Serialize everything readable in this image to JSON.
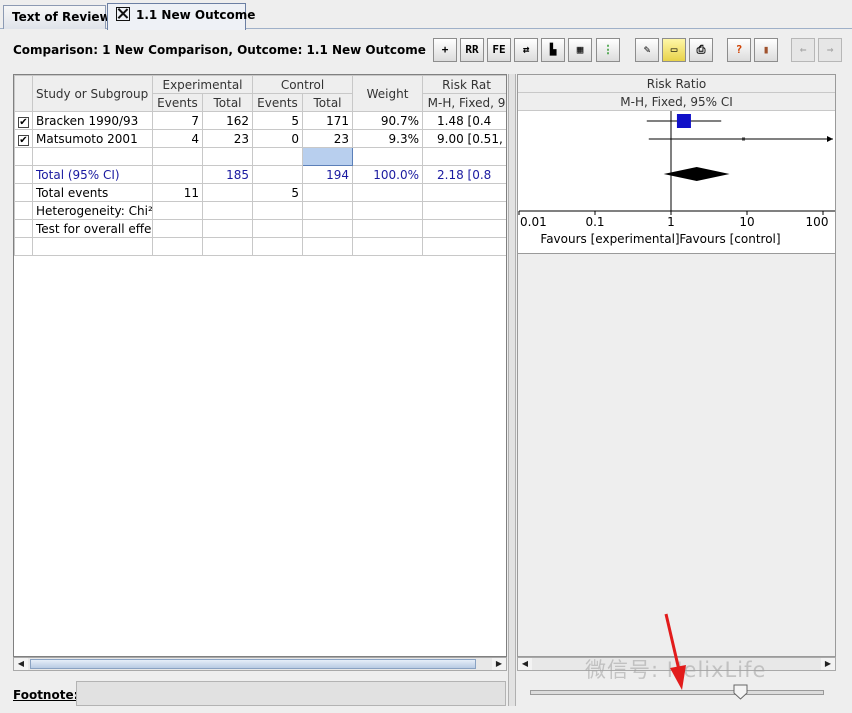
{
  "tabs": [
    {
      "label": "Text of Review"
    },
    {
      "label": "1.1 New Outcome"
    }
  ],
  "title": "Comparison: 1 New Comparison, Outcome: 1.1 New Outcome",
  "toolbar": {
    "buttons": [
      {
        "name": "add-study-icon",
        "label": "+"
      },
      {
        "name": "rr-button",
        "label": "RR"
      },
      {
        "name": "fe-button",
        "label": "FE"
      },
      {
        "name": "sort-icon",
        "label": "⇄"
      },
      {
        "name": "graph-icon",
        "label": "▙"
      },
      {
        "name": "calculator-icon",
        "label": "▦"
      },
      {
        "name": "grid-icon",
        "label": "⋮"
      },
      {
        "name": "properties-icon",
        "label": "✎"
      },
      {
        "name": "note-icon",
        "label": "▭"
      },
      {
        "name": "print-icon",
        "label": "⎙"
      },
      {
        "name": "help-icon",
        "label": "?"
      },
      {
        "name": "book-icon",
        "label": "▮"
      },
      {
        "name": "back-icon",
        "label": "←"
      },
      {
        "name": "forward-icon",
        "label": "→"
      }
    ]
  },
  "table": {
    "headers": {
      "study": "Study or Subgroup",
      "experimental": "Experimental",
      "control": "Control",
      "weight": "Weight",
      "risk_ratio": "Risk Rat",
      "events": "Events",
      "total": "Total",
      "method": "M-H, Fixed, 9"
    },
    "rows": [
      {
        "study": "Bracken 1990/93",
        "checked": "✔",
        "e_events": "7",
        "e_total": "162",
        "c_events": "5",
        "c_total": "171",
        "weight": "90.7%",
        "rr": "1.48 [0.4"
      },
      {
        "study": "Matsumoto 2001",
        "checked": "✔",
        "e_events": "4",
        "e_total": "23",
        "c_events": "0",
        "c_total": "23",
        "weight": "9.3%",
        "rr": "9.00 [0.51,"
      }
    ],
    "total_row": {
      "study": "Total (95% CI)",
      "e_total": "185",
      "c_total": "194",
      "weight": "100.0%",
      "rr": "2.18 [0.8"
    },
    "events_row": {
      "label": "Total events",
      "e_events": "11",
      "c_events": "5"
    },
    "heterogeneity": "Heterogeneity: Chi² ...",
    "overall": "Test for overall effe..."
  },
  "forest": {
    "header": "Risk Ratio",
    "subheader": "M-H, Fixed, 95% CI",
    "ticks": [
      "0.01",
      "0.1",
      "1",
      "10",
      "100"
    ],
    "favours_left": "Favours [experimental]",
    "favours_right": "Favours [control]"
  },
  "chart_data": {
    "type": "scatter",
    "title": "Risk Ratio",
    "subtitle": "M-H, Fixed, 95% CI",
    "x_scale": "log",
    "xlim": [
      0.01,
      100
    ],
    "tick_labels": [
      "0.01",
      "0.1",
      "1",
      "10",
      "100"
    ],
    "studies": [
      {
        "name": "Bracken 1990/93",
        "rr": 1.48,
        "ci_low": 0.48,
        "ci_high": 4.58,
        "weight": 90.7
      },
      {
        "name": "Matsumoto 2001",
        "rr": 9.0,
        "ci_low": 0.51,
        "ci_high": 158
      }
    ],
    "pooled": {
      "rr": 2.18,
      "ci_low": 0.8,
      "ci_high": 5.9
    },
    "xlabel_left": "Favours [experimental]",
    "xlabel_right": "Favours [control]"
  },
  "footnote": {
    "label": "Footnote:",
    "value": ""
  },
  "watermark": "微信号: HelixLife",
  "colors": {
    "study_box": "#1010c8",
    "pooled_diamond": "#000000",
    "total_text": "#1a1aa0"
  }
}
